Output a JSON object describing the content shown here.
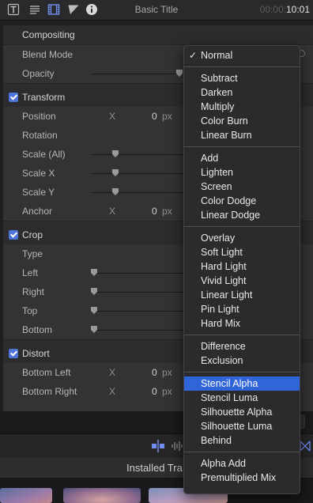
{
  "toolbar": {
    "title": "Basic Title",
    "timecode_dim": "00:00:",
    "timecode_bright": "10:01",
    "icons": [
      "text-inspector-icon",
      "paragraph-icon",
      "video-inspector-icon",
      "color-triangle-icon",
      "info-icon"
    ]
  },
  "inspector": {
    "compositing": {
      "label": "Compositing",
      "blend_mode_label": "Blend Mode",
      "opacity_label": "Opacity"
    },
    "transform": {
      "label": "Transform",
      "position_label": "Position",
      "position_axis": "X",
      "position_x": "0",
      "position_unit": "px",
      "rotation_label": "Rotation",
      "scale_all_label": "Scale (All)",
      "scale_x_label": "Scale X",
      "scale_y_label": "Scale Y",
      "anchor_label": "Anchor",
      "anchor_axis": "X",
      "anchor_x": "0",
      "anchor_unit": "px"
    },
    "crop": {
      "label": "Crop",
      "type_label": "Type",
      "left_label": "Left",
      "right_label": "Right",
      "top_label": "Top",
      "bottom_label": "Bottom"
    },
    "distort": {
      "label": "Distort",
      "bottom_left_label": "Bottom Left",
      "bottom_left_axis": "X",
      "bottom_left_x": "0",
      "bottom_left_unit": "px",
      "bottom_right_label": "Bottom Right",
      "bottom_right_axis": "X",
      "bottom_right_x": "0",
      "bottom_right_unit": "px"
    }
  },
  "browser": {
    "header": "Installed Tra"
  },
  "blend_menu": {
    "checked_mark": "✓",
    "checked": "Normal",
    "highlighted": "Stencil Alpha",
    "groups": [
      [
        "Normal"
      ],
      [
        "Subtract",
        "Darken",
        "Multiply",
        "Color Burn",
        "Linear Burn"
      ],
      [
        "Add",
        "Lighten",
        "Screen",
        "Color Dodge",
        "Linear Dodge"
      ],
      [
        "Overlay",
        "Soft Light",
        "Hard Light",
        "Vivid Light",
        "Linear Light",
        "Pin Light",
        "Hard Mix"
      ],
      [
        "Difference",
        "Exclusion"
      ],
      [
        "Stencil Alpha",
        "Stencil Luma",
        "Silhouette Alpha",
        "Silhouette Luma",
        "Behind"
      ],
      [
        "Alpha Add",
        "Premultiplied Mix"
      ]
    ]
  },
  "colors": {
    "accent": "#2f65d8",
    "checkbox": "#4d74d9"
  }
}
